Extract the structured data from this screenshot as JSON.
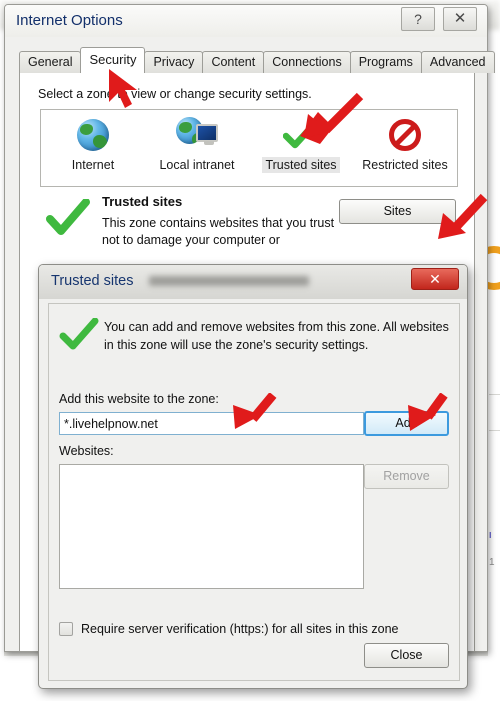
{
  "window": {
    "title": "Internet Options",
    "help_button": "?",
    "close_button": "✕"
  },
  "tabs": [
    {
      "label": "General",
      "active": false
    },
    {
      "label": "Security",
      "active": true
    },
    {
      "label": "Privacy",
      "active": false
    },
    {
      "label": "Content",
      "active": false
    },
    {
      "label": "Connections",
      "active": false
    },
    {
      "label": "Programs",
      "active": false
    },
    {
      "label": "Advanced",
      "active": false
    }
  ],
  "security_tab": {
    "zone_prompt": "Select a zone to view or change security settings.",
    "zones": [
      {
        "label": "Internet",
        "icon": "globe-icon",
        "selected": false
      },
      {
        "label": "Local intranet",
        "icon": "globe-monitor-icon",
        "selected": false
      },
      {
        "label": "Trusted sites",
        "icon": "green-check-icon",
        "selected": true
      },
      {
        "label": "Restricted sites",
        "icon": "no-entry-icon",
        "selected": false
      }
    ],
    "selected_zone": {
      "title": "Trusted sites",
      "description": "This zone contains websites that you trust not to damage your computer or",
      "icon": "green-check-icon"
    },
    "sites_button": "Sites"
  },
  "trusted_sites_dialog": {
    "title": "Trusted sites",
    "close_x": "✕",
    "info_icon": "green-check-icon",
    "info_text": "You can add and remove websites from this zone. All websites in this zone will use the zone's security settings.",
    "add_label": "Add this website to the zone:",
    "website_value": "*.livehelpnow.net",
    "website_placeholder": "",
    "add_button": "Add",
    "websites_label": "Websites:",
    "websites": [],
    "remove_button": "Remove",
    "remove_enabled": false,
    "require_https_label": "Require server verification (https:) for all sites in this zone",
    "require_https_checked": false,
    "close_button": "Close"
  },
  "annotations": {
    "arrow_color": "#e01b1b",
    "arrows": [
      {
        "name": "arrow-security-tab",
        "target": "Security tab"
      },
      {
        "name": "arrow-trusted-sites-zone",
        "target": "Trusted sites zone"
      },
      {
        "name": "arrow-sites-button",
        "target": "Sites button"
      },
      {
        "name": "arrow-website-input",
        "target": "website input"
      },
      {
        "name": "arrow-add-button",
        "target": "Add button"
      }
    ]
  },
  "background": {
    "link_fragment": "i",
    "number_fragment": "1"
  }
}
